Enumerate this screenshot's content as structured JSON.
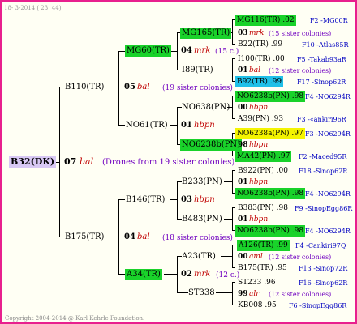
{
  "header": {
    "date": "18-  3-2014 ( 23: 44)"
  },
  "footer": {
    "copyright": "Copyright 2004-2014 @ Karl Kehrle Foundation."
  },
  "root": {
    "id": "B32(DK)",
    "gen": "07",
    "mark": "bal",
    "note": "(Drones from 19 sister colonies)"
  },
  "l1": {
    "a": {
      "id": "B110(TR)",
      "gen": "05",
      "mark": "bal",
      "note": "(19 sister colonies)"
    },
    "b": {
      "id": "B175(TR)",
      "gen": "04",
      "mark": "bal",
      "note": "(18 sister colonies)"
    }
  },
  "l2": {
    "a": {
      "id": "MG60(TR)"
    },
    "b": {
      "id": "NO61(TR)",
      "gen": "01",
      "mark": "hbpn"
    },
    "c": {
      "id": "B146(TR)"
    },
    "d": {
      "id": "A34(TR)",
      "gen": "02",
      "mark": "mrk",
      "note": "(12 c.)"
    }
  },
  "l3": {
    "a": {
      "id": "MG165(TR)",
      "gen": "04",
      "mark": "mrk",
      "note": "(15 c.)"
    },
    "b": {
      "id": "I89(TR)"
    },
    "c": {
      "id": "NO638(PN)"
    },
    "d": {
      "id": "NO6238b(PN)"
    },
    "e": {
      "id": "B233(PN)",
      "gen": "03",
      "mark": "hbpn"
    },
    "f": {
      "id": "B483(PN)"
    },
    "g": {
      "id": "A23(TR)"
    },
    "h": {
      "id": "ST338"
    }
  },
  "l4": [
    {
      "id": "MG116(TR)",
      "val": ".02",
      "code": "F2 -MG00R"
    },
    {
      "gen": "03",
      "mark": "mrk",
      "note": "(15 sister colonies)"
    },
    {
      "id": "B22(TR)",
      "val": ".99",
      "code": "F10 -Atlas85R"
    },
    {
      "id": "I100(TR)",
      "val": ".00",
      "code": "F5 -Takab93aR"
    },
    {
      "gen": "01",
      "mark": "bal",
      "note": "(12 sister colonies)"
    },
    {
      "id": "B92(TR)",
      "val": ".99",
      "code": "F17 -Sinop62R"
    },
    {
      "id": "NO6238b(PN)",
      "val": ".98",
      "code": "F4 -NO6294R"
    },
    {
      "gen": "00",
      "mark": "hbpn"
    },
    {
      "id": "A39(PN)",
      "val": ".93",
      "code": "F3 -«ankiri96R"
    },
    {
      "id": "NO6238a(PN)",
      "val": ".97",
      "code": "F3 -NO6294R"
    },
    {
      "gen": "98",
      "mark": "hbpn"
    },
    {
      "id": "MA42(PN)",
      "val": ".97",
      "code": "F2 -Maced95R"
    },
    {
      "id": "B922(PN)",
      "val": ".00",
      "code": "F18 -Sinop62R"
    },
    {
      "gen": "01",
      "mark": "hbpn"
    },
    {
      "id": "NO6238b(PN)",
      "val": ".98",
      "code": "F4 -NO6294R"
    },
    {
      "id": "B383(PN)",
      "val": ".98",
      "code": "F9 -SinopEgg86R"
    },
    {
      "gen": "01",
      "mark": "hbpn"
    },
    {
      "id": "NO6238b(PN)",
      "val": ".98",
      "code": "F4 -NO6294R"
    },
    {
      "id": "A126(TR)",
      "val": ".99",
      "code": "F4 -Cankiri97Q"
    },
    {
      "gen": "00",
      "mark": "aml",
      "note": "(12 sister colonies)"
    },
    {
      "id": "B175(TR)",
      "val": ".95",
      "code": "F13 -Sinop72R"
    },
    {
      "id": "ST233",
      "val": ".96",
      "code": "F16 -Sinop62R"
    },
    {
      "gen": "99",
      "mark": "alr",
      "note": "(12 sister colonies)"
    },
    {
      "id": "KB008",
      "val": ".95",
      "code": "F6 -SinopEgg86R"
    }
  ]
}
